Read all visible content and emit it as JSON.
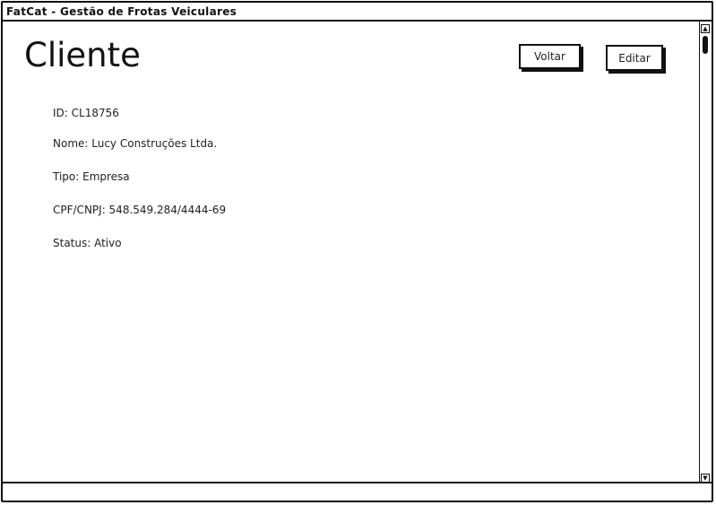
{
  "window": {
    "title": "FatCat - Gestão de Frotas Veiculares"
  },
  "page": {
    "title": "Cliente"
  },
  "actions": {
    "back_label": "Voltar",
    "edit_label": "Editar"
  },
  "client": {
    "id": "ID: CL18756",
    "name": "Nome: Lucy Construções Ltda.",
    "type": "Tipo: Empresa",
    "document": "CPF/CNPJ: 548.549.284/4444-69",
    "status": "Status: Ativo"
  },
  "icons": {
    "scroll_up": "triangle-up",
    "scroll_down": "triangle-down"
  }
}
